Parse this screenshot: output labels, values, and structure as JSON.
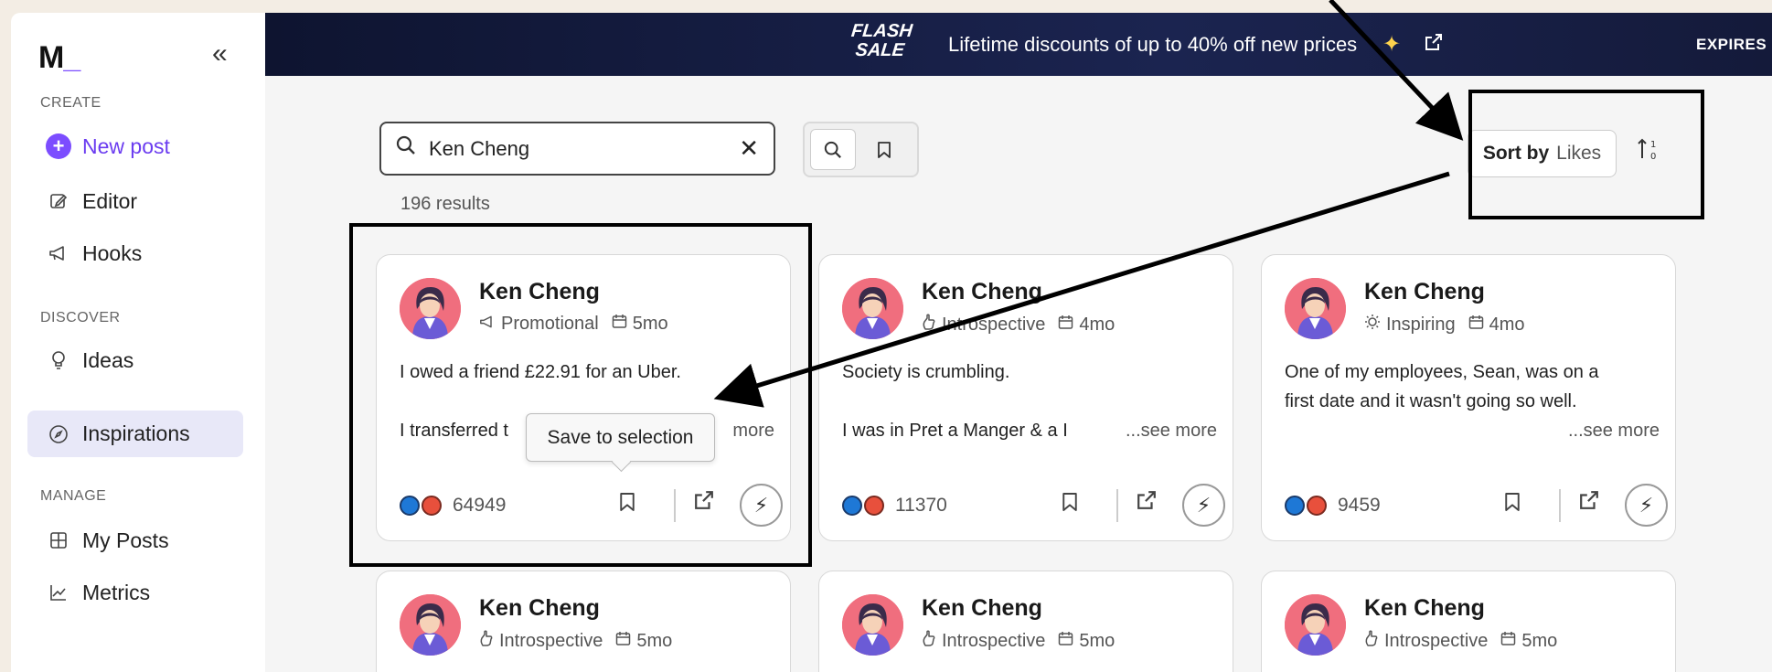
{
  "sidebar": {
    "logo": "M",
    "logo_suffix": "_",
    "collapse_glyph": "«",
    "sections": {
      "create": "CREATE",
      "discover": "DISCOVER",
      "manage": "MANAGE"
    },
    "items": [
      {
        "label": "New post",
        "icon": "plus-icon"
      },
      {
        "label": "Editor",
        "icon": "edit-icon"
      },
      {
        "label": "Hooks",
        "icon": "megaphone-icon"
      },
      {
        "label": "Ideas",
        "icon": "lightbulb-icon"
      },
      {
        "label": "Inspirations",
        "icon": "compass-icon",
        "active": true
      },
      {
        "label": "My Posts",
        "icon": "grid-icon"
      },
      {
        "label": "Metrics",
        "icon": "chart-icon"
      }
    ]
  },
  "banner": {
    "flash_line1": "FLASH",
    "flash_line2": "SALE",
    "text": "Lifetime discounts of up to 40% off new prices",
    "expires": "EXPIRES"
  },
  "search": {
    "value": "Ken Cheng",
    "results": "196 results"
  },
  "sort": {
    "label": "Sort by",
    "value": "Likes"
  },
  "tooltip": "Save to selection",
  "posts": [
    {
      "author": "Ken Cheng",
      "tag": "Promotional",
      "tag_icon": "megaphone-icon",
      "age": "5mo",
      "line1": "I owed a friend £22.91 for an Uber.",
      "line2": "I transferred t",
      "see_more": "more",
      "count": "64949"
    },
    {
      "author": "Ken Cheng",
      "tag": "Introspective",
      "tag_icon": "hand-icon",
      "age": "4mo",
      "line1": "Society is crumbling.",
      "line2": "I was in Pret a Manger & a I",
      "see_more": "...see more",
      "count": "11370"
    },
    {
      "author": "Ken Cheng",
      "tag": "Inspiring",
      "tag_icon": "sun-icon",
      "age": "4mo",
      "line1": "One of my employees, Sean, was on a",
      "line2": "first date and it wasn't going so well.",
      "see_more": "...see more",
      "count": "9459"
    },
    {
      "author": "Ken Cheng",
      "tag": "Introspective",
      "tag_icon": "hand-icon",
      "age": "5mo"
    },
    {
      "author": "Ken Cheng",
      "tag": "Introspective",
      "tag_icon": "hand-icon",
      "age": "5mo"
    },
    {
      "author": "Ken Cheng",
      "tag": "Introspective",
      "tag_icon": "hand-icon",
      "age": "5mo"
    }
  ],
  "colors": {
    "accent": "#7c4dff",
    "banner": "#141a3a",
    "active_nav": "#e8e8f8"
  }
}
